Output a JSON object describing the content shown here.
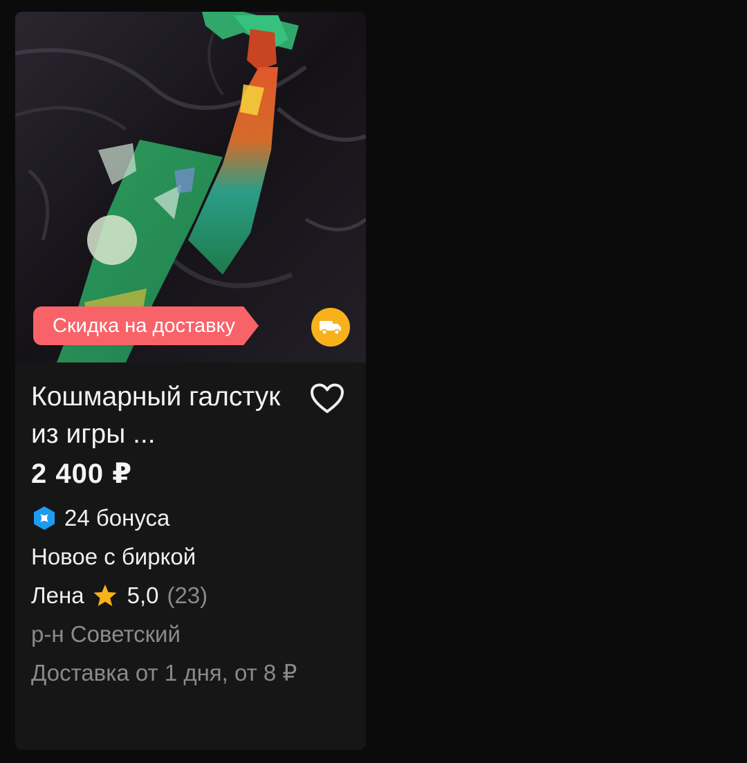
{
  "card": {
    "promo_badge": "Скидка на доставку",
    "delivery_icon": "truck-icon",
    "title": "Кошмарный галстук из игры ...",
    "favorite_icon": "heart-outline-icon",
    "price": "2 400 ₽",
    "bonus": {
      "icon": "bonus-gem-icon",
      "text": "24 бонуса"
    },
    "condition": "Новое с биркой",
    "seller": {
      "name": "Лена",
      "star_icon": "star-icon",
      "rating": "5,0",
      "reviews": "(23)"
    },
    "location": "р-н Советский",
    "delivery": "Доставка от 1 дня, от 8 ₽"
  },
  "colors": {
    "background": "#0b0b0b",
    "card": "#161616",
    "promo": "#f86369",
    "delivery_badge": "#f7b21b",
    "bonus": "#1d9bf0",
    "star": "#f7b21b",
    "muted_text": "#8a8a8a"
  }
}
